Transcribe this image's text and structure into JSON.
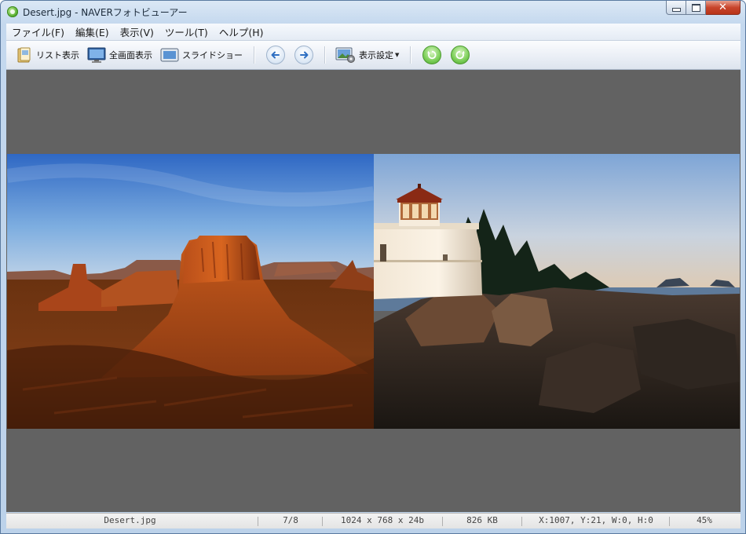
{
  "window": {
    "title": "Desert.jpg - NAVERフォトビューアー"
  },
  "menu": {
    "items": [
      "ファイル(F)",
      "編集(E)",
      "表示(V)",
      "ツール(T)",
      "ヘルプ(H)"
    ]
  },
  "toolbar": {
    "list_view": "リスト表示",
    "fullscreen": "全画面表示",
    "slideshow": "スライドショー",
    "display_settings": "表示設定"
  },
  "viewer": {
    "left_image": "desert-mesa-photo",
    "right_image": "lighthouse-coast-photo"
  },
  "status": {
    "filename": "Desert.jpg",
    "position": "7/8",
    "dimensions": "1024 x 768 x 24b",
    "filesize": "826 KB",
    "cursor": "X:1007, Y:21, W:0, H:0",
    "zoom": "45%"
  },
  "colors": {
    "viewer_bg": "#626262",
    "rotate_green": "#5bb83a",
    "nav_blue": "#3b78c9"
  }
}
